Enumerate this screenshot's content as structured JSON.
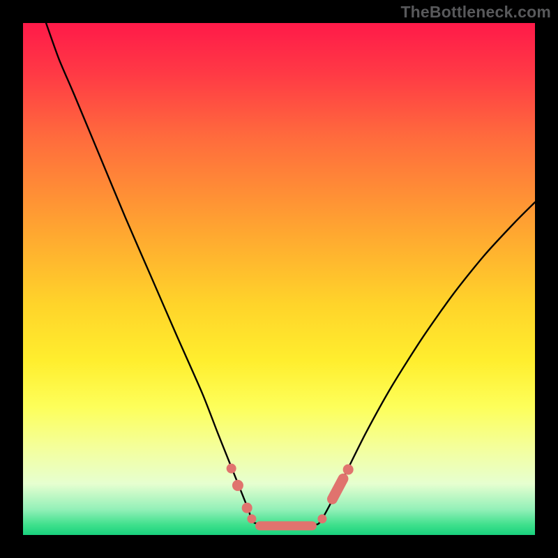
{
  "watermark": "TheBottleneck.com",
  "colors": {
    "page_bg": "#000000",
    "curve_stroke": "#000000",
    "marker_fill": "#e0736e",
    "gradient_top": "#ff1a49",
    "gradient_bottom": "#19d27e"
  },
  "chart_data": {
    "type": "line",
    "title": "",
    "xlabel": "",
    "ylabel": "",
    "xlim": [
      0,
      100
    ],
    "ylim": [
      0,
      100
    ],
    "description": "V-shaped bottleneck curve on a red-to-green vertical gradient. Left branch falls steeply from top-left, flattens to a wide minimum near y≈2 for x≈45–58, then right branch rises more gently toward the upper right. Coral markers sit along the curve near the trough flanks.",
    "series": [
      {
        "name": "left-branch",
        "x": [
          4.5,
          7,
          10,
          15,
          20,
          25,
          30,
          35,
          38,
          40,
          42,
          44,
          45
        ],
        "y": [
          100,
          93,
          86,
          74,
          62,
          50.5,
          39,
          27.7,
          20,
          15,
          10,
          5,
          2.5
        ]
      },
      {
        "name": "trough",
        "x": [
          45,
          48,
          51,
          54,
          57,
          58
        ],
        "y": [
          2.5,
          1.8,
          1.6,
          1.7,
          2.0,
          2.5
        ]
      },
      {
        "name": "right-branch",
        "x": [
          58,
          60,
          63,
          67,
          72,
          78,
          84,
          90,
          96,
          100
        ],
        "y": [
          2.5,
          6,
          12,
          20,
          29,
          38.5,
          47,
          54.5,
          61,
          65
        ]
      }
    ],
    "markers": [
      {
        "kind": "dot",
        "x": 40.7,
        "y": 13.0,
        "r": 1.0
      },
      {
        "kind": "dot",
        "x": 42.0,
        "y": 9.7,
        "r": 1.1
      },
      {
        "kind": "dot",
        "x": 43.8,
        "y": 5.3,
        "r": 1.0
      },
      {
        "kind": "dot",
        "x": 44.7,
        "y": 3.2,
        "r": 0.9
      },
      {
        "kind": "capsule",
        "cx": 51.3,
        "cy": 1.8,
        "len": 12.0,
        "angle": 0,
        "thick": 1.8
      },
      {
        "kind": "dot",
        "x": 58.4,
        "y": 3.2,
        "r": 0.9
      },
      {
        "kind": "capsule",
        "cx": 61.5,
        "cy": 9.0,
        "len": 6.5,
        "angle": 62,
        "thick": 2.0
      },
      {
        "kind": "dot",
        "x": 63.5,
        "y": 12.8,
        "r": 1.0
      }
    ]
  }
}
